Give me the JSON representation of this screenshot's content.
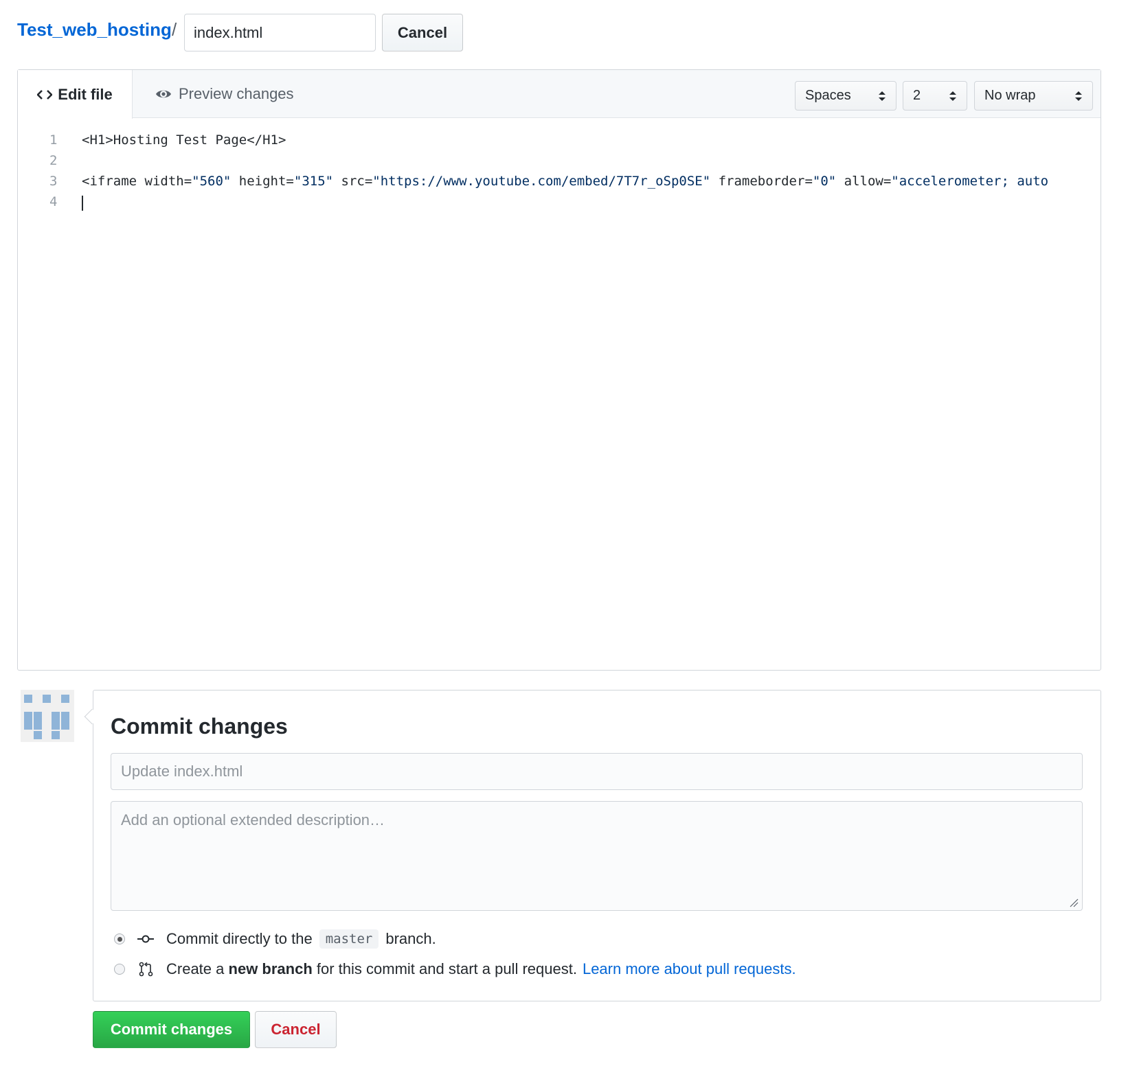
{
  "header": {
    "repo_name": "Test_web_hosting",
    "separator": "/",
    "filename_value": "index.html",
    "cancel_label": "Cancel"
  },
  "editor": {
    "tabs": {
      "edit_label": "Edit file",
      "preview_label": "Preview changes",
      "active": "Edit file"
    },
    "indent_mode": "Spaces",
    "indent_size": "2",
    "wrap_mode": "No wrap",
    "line_numbers": [
      "1",
      "2",
      "3",
      "4"
    ],
    "line1": "<H1>Hosting Test Page</H1>",
    "line3": {
      "t1": "<iframe width=",
      "s1": "\"560\"",
      "t2": " height=",
      "s2": "\"315\"",
      "t3": " src=",
      "s3": "\"https://www.youtube.com/embed/7T7r_oSp0SE\"",
      "t4": " frameborder=",
      "s4": "\"0\"",
      "t5": " allow=",
      "s5": "\"accelerometer; auto"
    }
  },
  "commit": {
    "title": "Commit changes",
    "summary_placeholder": "Update index.html",
    "description_placeholder": "Add an optional extended description…",
    "option_direct": {
      "before": "Commit directly to the",
      "branch": "master",
      "after": "branch."
    },
    "option_new_branch": {
      "before": "Create a",
      "bold": "new branch",
      "after": "for this commit and start a pull request.",
      "link": "Learn more about pull requests."
    },
    "selected_option": "direct",
    "submit_label": "Commit changes",
    "cancel_label": "Cancel"
  },
  "colors": {
    "link": "#0366d6",
    "primary_button": "#28a745",
    "danger_text": "#cb2431",
    "code_string": "#032f62"
  },
  "icons": {
    "edit_tab": "code-icon",
    "preview_tab": "eye-icon",
    "direct_option": "git-commit-icon",
    "branch_option": "git-pull-request-icon"
  }
}
